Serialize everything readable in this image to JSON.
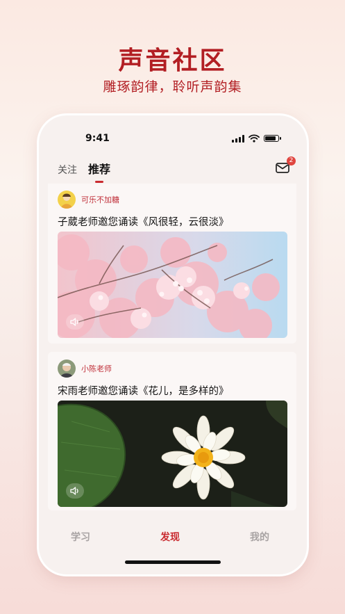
{
  "promo": {
    "title": "声音社区",
    "subtitle": "雕琢韵律，聆听声韵集"
  },
  "status_bar": {
    "time": "9:41",
    "icons": [
      "signal-icon",
      "wifi-icon",
      "battery-icon"
    ]
  },
  "tabs": [
    {
      "label": "关注",
      "active": false
    },
    {
      "label": "推荐",
      "active": true
    }
  ],
  "mail": {
    "icon": "mail-icon",
    "badge": "2"
  },
  "posts": [
    {
      "author": "可乐不加糖",
      "title": "子葳老师邀您诵读《风很轻，云很淡》",
      "image": "cherry-blossom-image",
      "sound_icon": "speaker-icon"
    },
    {
      "author": "小陈老师",
      "title": "宋雨老师邀您诵读《花儿，是多样的》",
      "image": "water-lily-image",
      "sound_icon": "speaker-icon"
    }
  ],
  "bottom_nav": [
    {
      "label": "学习",
      "active": false
    },
    {
      "label": "发现",
      "active": true
    },
    {
      "label": "我的",
      "active": false
    }
  ],
  "colors": {
    "accent": "#c92a2f",
    "promo_red": "#b21e23",
    "background": "#fbf3ee"
  }
}
